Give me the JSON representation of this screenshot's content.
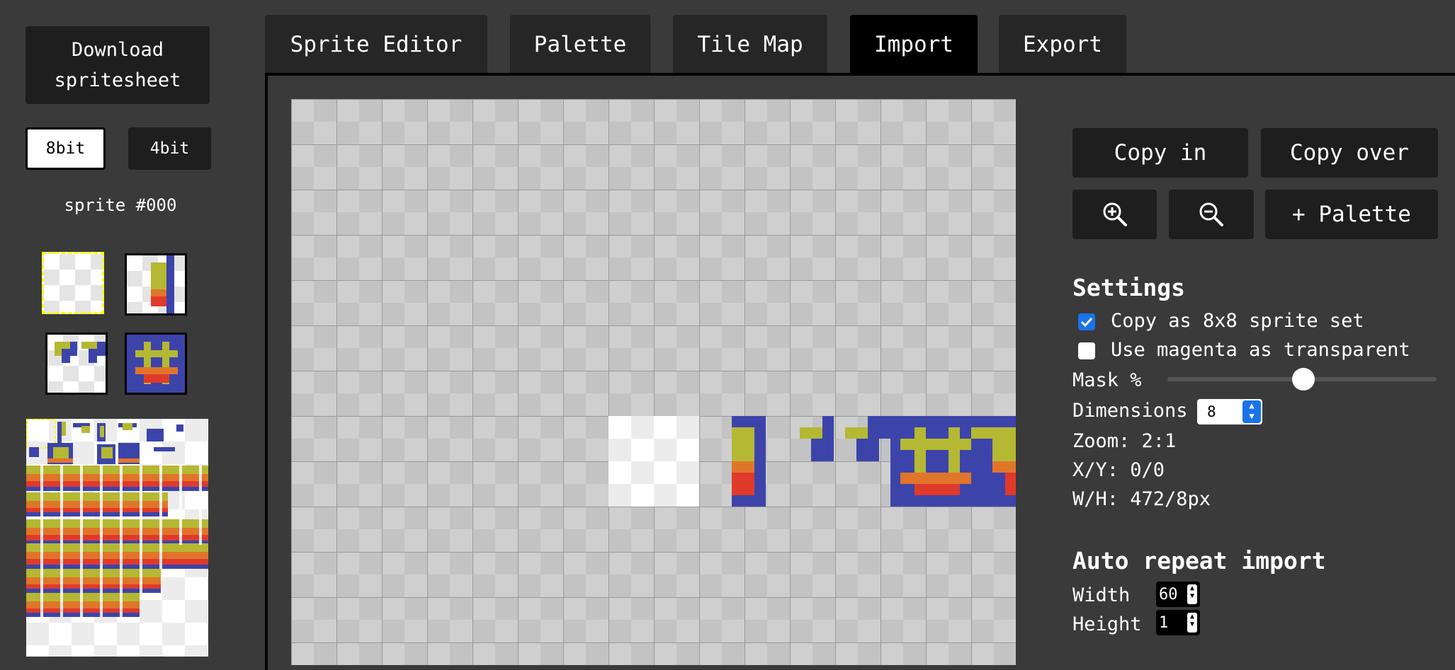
{
  "sidebar": {
    "download_label": "Download spritesheet",
    "bit_options": [
      "8bit",
      "4bit"
    ],
    "selected_bit": "8bit",
    "sprite_label": "sprite #000"
  },
  "tabs": [
    {
      "label": "Sprite Editor",
      "active": false
    },
    {
      "label": "Palette",
      "active": false
    },
    {
      "label": "Tile Map",
      "active": false
    },
    {
      "label": "Import",
      "active": true
    },
    {
      "label": "Export",
      "active": false
    }
  ],
  "tools": {
    "copy_in": "Copy in",
    "copy_over": "Copy over",
    "zoom_in_icon": "zoom-in-icon",
    "zoom_out_icon": "zoom-out-icon",
    "add_palette": "+ Palette"
  },
  "settings": {
    "title": "Settings",
    "copy_as_sprite_set": {
      "label": "Copy as 8x8 sprite set",
      "checked": true
    },
    "magenta_transparent": {
      "label": "Use magenta as transparent",
      "checked": false
    },
    "mask_label": "Mask %",
    "mask_value": 50,
    "dimensions_label": "Dimensions",
    "dimensions_value": "8",
    "zoom_text": "Zoom: 2:1",
    "xy_text": "X/Y: 0/0",
    "wh_text": "W/H: 472/8px"
  },
  "auto_repeat": {
    "title": "Auto repeat import",
    "width_label": "Width",
    "width_value": "60",
    "height_label": "Height",
    "height_value": "1"
  },
  "colors": {
    "background": "#3a3a3a",
    "button": "#1e1e1e",
    "accent_checkbox": "#1a73e8",
    "sprite_blue": "#3c44aa",
    "sprite_yellow": "#b5b832",
    "sprite_orange": "#e0752a",
    "sprite_red": "#e03a2a",
    "selection_yellow": "#ffff00"
  }
}
